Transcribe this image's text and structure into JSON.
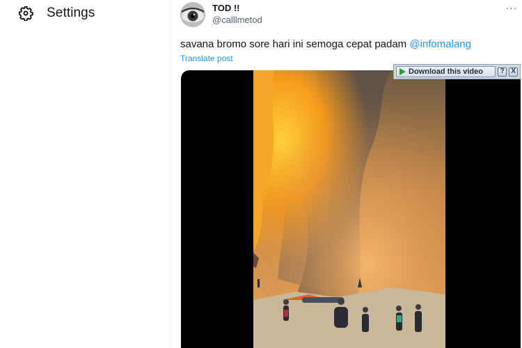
{
  "nav": {
    "settings_label": "Settings",
    "settings_icon": "gear-icon"
  },
  "post": {
    "author_name": "TOD !!",
    "author_handle": "@calllmetod",
    "text": "savana bromo sore hari ini semoga cepat padam ",
    "mention": "@infomalang",
    "translate": "Translate post",
    "more_icon": "more-icon",
    "more_glyph": "···"
  },
  "download_bar": {
    "label": "Download this video",
    "help": "?",
    "close": "X"
  },
  "colors": {
    "link": "#1d9bf0",
    "text": "#0f1419",
    "secondary": "#536471"
  }
}
